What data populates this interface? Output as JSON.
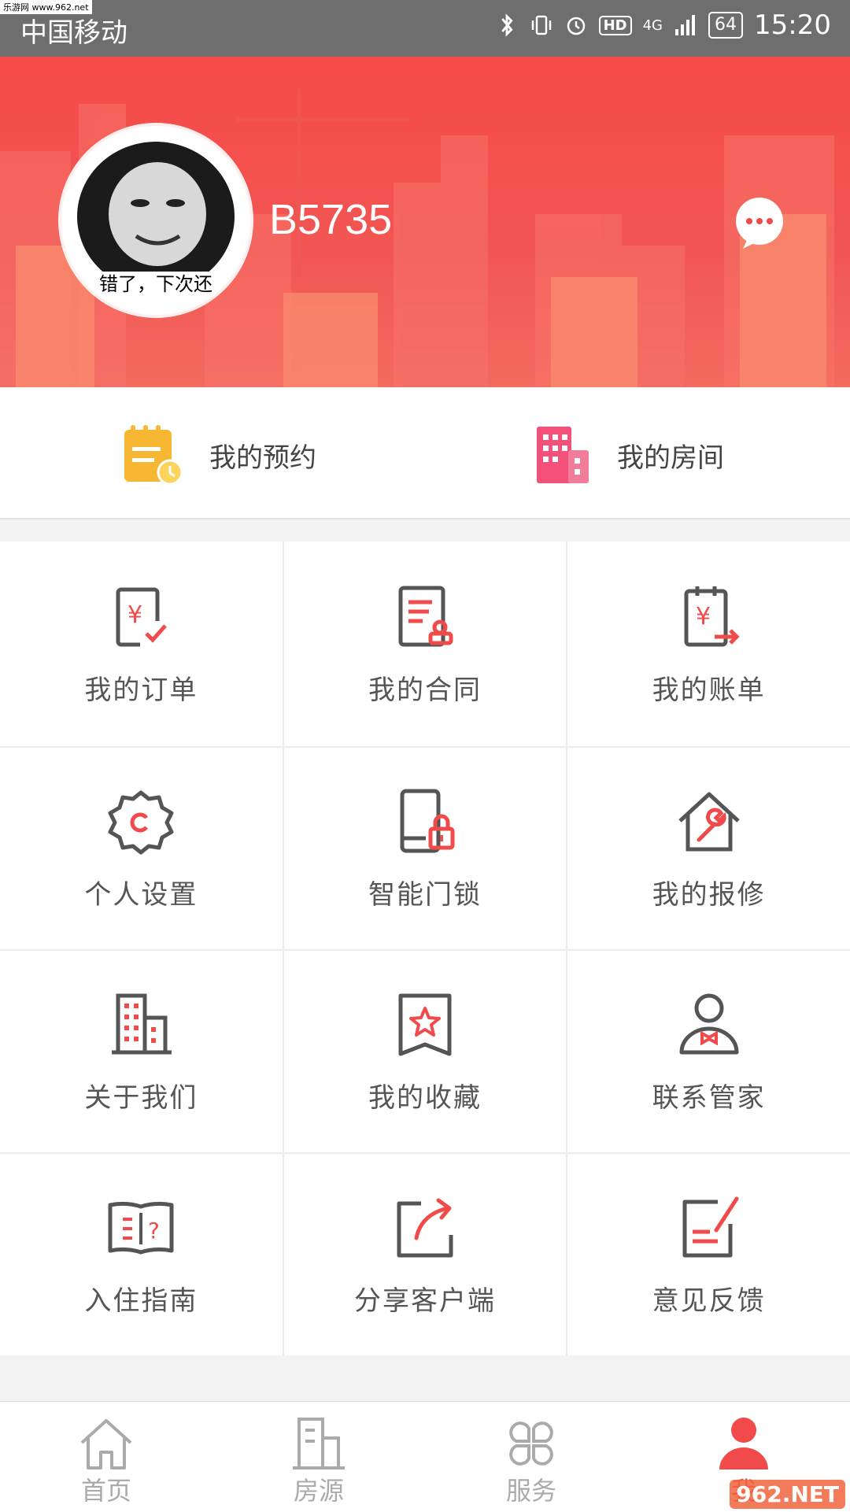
{
  "status_bar": {
    "corner_tag": "乐游网 www.962.net",
    "carrier": "中国移动",
    "hd": "HD",
    "network": "4G",
    "battery": "64",
    "time": "15:20"
  },
  "profile": {
    "avatar_caption": "错了，下次还",
    "username": "B5735"
  },
  "shortcuts": [
    {
      "label": "我的预约",
      "icon": "calendar-clock-icon"
    },
    {
      "label": "我的房间",
      "icon": "building-icon"
    }
  ],
  "grid": [
    {
      "label": "我的订单",
      "icon": "order-yen-check-icon"
    },
    {
      "label": "我的合同",
      "icon": "contract-seal-icon"
    },
    {
      "label": "我的账单",
      "icon": "bill-yen-arrow-icon"
    },
    {
      "label": "个人设置",
      "icon": "gear-icon"
    },
    {
      "label": "智能门锁",
      "icon": "phone-lock-icon"
    },
    {
      "label": "我的报修",
      "icon": "house-wrench-icon"
    },
    {
      "label": "关于我们",
      "icon": "office-building-icon"
    },
    {
      "label": "我的收藏",
      "icon": "star-bookmark-icon"
    },
    {
      "label": "联系管家",
      "icon": "butler-icon"
    },
    {
      "label": "入住指南",
      "icon": "guide-book-icon"
    },
    {
      "label": "分享客户端",
      "icon": "share-arrow-icon"
    },
    {
      "label": "意见反馈",
      "icon": "feedback-pen-icon"
    }
  ],
  "bottom_nav": [
    {
      "label": "首页",
      "icon": "home-icon",
      "active": false
    },
    {
      "label": "房源",
      "icon": "building-outline-icon",
      "active": false
    },
    {
      "label": "服务",
      "icon": "grid-clover-icon",
      "active": false
    },
    {
      "label": "我",
      "icon": "person-icon",
      "active": true
    }
  ],
  "watermark": "962.NET",
  "colors": {
    "accent": "#f04a4a",
    "banner": "#f25653",
    "icon_gray": "#555555",
    "icon_red": "#f04a4a",
    "shortcut_yellow": "#f7b733"
  }
}
